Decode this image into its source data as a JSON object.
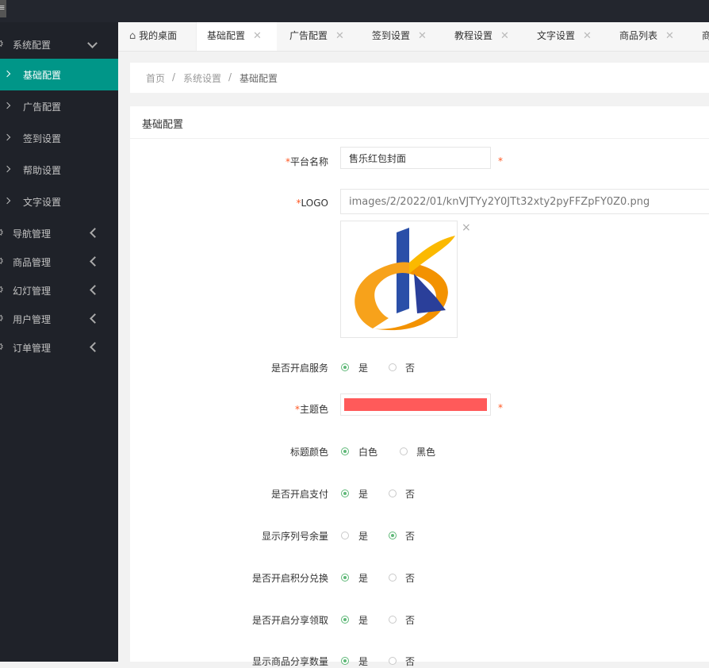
{
  "header": {
    "menu_icon": "hamburger-icon"
  },
  "sidebar": {
    "groups": [
      {
        "label": "系统配置",
        "expanded": true
      },
      {
        "label": "导航管理",
        "expanded": false
      },
      {
        "label": "商品管理",
        "expanded": false
      },
      {
        "label": "幻灯管理",
        "expanded": false
      },
      {
        "label": "用户管理",
        "expanded": false
      },
      {
        "label": "订单管理",
        "expanded": false
      }
    ],
    "sub_items": [
      {
        "label": "基础配置",
        "active": true
      },
      {
        "label": "广告配置"
      },
      {
        "label": "签到设置"
      },
      {
        "label": "帮助设置"
      },
      {
        "label": "文字设置"
      }
    ],
    "active_color": "#009688"
  },
  "tabs": {
    "home": "我的桌面",
    "items": [
      "基础配置",
      "广告配置",
      "签到设置",
      "教程设置",
      "文字设置",
      "商品列表",
      "商"
    ]
  },
  "breadcrumb": {
    "items": [
      "首页",
      "系统设置",
      "基础配置"
    ],
    "separator": "/"
  },
  "form": {
    "title": "基础配置",
    "platform_name": {
      "label": "平台名称",
      "value": "售乐红包封面"
    },
    "logo": {
      "label": "LOGO",
      "value": "images/2/2022/01/knVJTYy2Y0JTt32xty2pyFFZpFY0Z0.png",
      "remove": "×"
    },
    "required_mark": "*",
    "service": {
      "label": "是否开启服务",
      "options": [
        "是",
        "否"
      ],
      "selected": 0
    },
    "theme_color": {
      "label": "主题色",
      "value": "#ff5a5a"
    },
    "title_color": {
      "label": "标题颜色",
      "options": [
        "白色",
        "黑色"
      ],
      "selected": 0
    },
    "payment": {
      "label": "是否开启支付",
      "options": [
        "是",
        "否"
      ],
      "selected": 0
    },
    "serial_remaining": {
      "label": "显示序列号余量",
      "options": [
        "是",
        "否"
      ],
      "selected": 1
    },
    "points_exchange": {
      "label": "是否开启积分兑换",
      "options": [
        "是",
        "否"
      ],
      "selected": 0
    },
    "share_claim": {
      "label": "是否开启分享领取",
      "options": [
        "是",
        "否"
      ],
      "selected": 0
    },
    "share_count": {
      "label": "显示商品分享数量",
      "options": [
        "是",
        "否"
      ],
      "selected": 0
    }
  },
  "colors": {
    "radio_on": "#5fb878",
    "required": "#ff5722",
    "sidebar_bg": "#1f2229"
  }
}
